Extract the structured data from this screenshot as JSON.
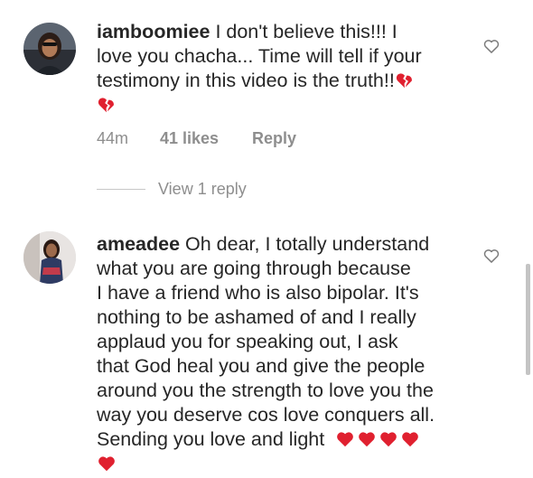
{
  "comments": [
    {
      "username": "iamboomiee",
      "lines": [
        "I don't believe this!!! I",
        "love you chacha... Time will tell if your",
        "testimony in this video is the truth!!"
      ],
      "time": "44m",
      "likes": "41 likes",
      "reply_label": "Reply",
      "view_replies": "View 1 reply",
      "emoji": "broken-heart-icon"
    },
    {
      "username": "ameadee",
      "lines": [
        "Oh dear, I totally understand",
        "what you are going through because",
        "I have a friend who is also bipolar. It's",
        "nothing to be ashamed of and I really",
        "applaud you for speaking out, I ask",
        "that God heal you and give the people",
        "around you the strength to love you the",
        "way you deserve cos love conquers all.",
        "Sending you love and light"
      ],
      "emoji": "red-heart-icon"
    }
  ],
  "colors": {
    "text": "#262626",
    "muted": "#8e8e8e",
    "heart_red": "#e0202f"
  }
}
